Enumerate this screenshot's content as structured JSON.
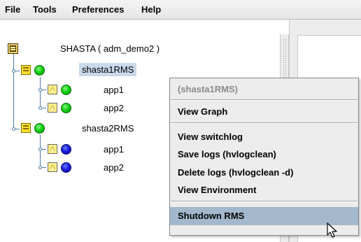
{
  "menubar": {
    "items": [
      {
        "label": "File"
      },
      {
        "label": "Tools"
      },
      {
        "label": "Preferences"
      },
      {
        "label": "Help"
      }
    ]
  },
  "tree": {
    "root": {
      "label": "SHASTA ( adm_demo2 )",
      "icon": "cluster-root-icon"
    },
    "nodes": [
      {
        "label": "shasta1RMS",
        "status": "online",
        "selected": true,
        "apps": [
          {
            "label": "app1",
            "status": "online"
          },
          {
            "label": "app2",
            "status": "online"
          }
        ]
      },
      {
        "label": "shasta2RMS",
        "status": "online",
        "apps": [
          {
            "label": "app1",
            "status": "offline"
          },
          {
            "label": "app2",
            "status": "offline"
          }
        ]
      }
    ]
  },
  "context_menu": {
    "header": "(shasta1RMS)",
    "items": [
      {
        "label": "View Graph"
      },
      {
        "label": "View switchlog"
      },
      {
        "label": "Save logs (hvlogclean)"
      },
      {
        "label": "Delete logs (hvlogclean -d)"
      },
      {
        "label": "View Environment"
      },
      {
        "label": "Shutdown RMS",
        "hovered": true
      }
    ]
  },
  "colors": {
    "online": "#0fd00f",
    "offline": "#1a1ee0",
    "selection": "#c9d9ea",
    "menu_hover": "#a3b8cc"
  }
}
